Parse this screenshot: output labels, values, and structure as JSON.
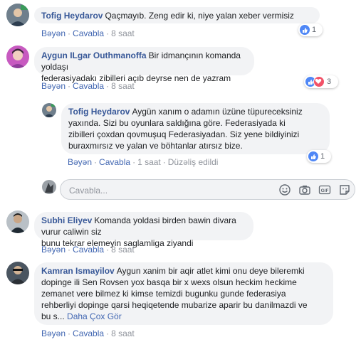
{
  "comments": [
    {
      "author": "Tofig Heydarov",
      "text": "Qaçmayıb. Zeng edir ki, niye yalan xeber vermisiz",
      "like_label": "Bəyən",
      "reply_label": "Cavabla",
      "time": "8 saat",
      "reaction_count": "1"
    },
    {
      "author": "Aygun ILgar Outhmanoffa",
      "text_lines": [
        "Bir idmançının komanda yoldaşı",
        "federasiyadakı zibilleri açıb deyrse nen de yazram"
      ],
      "like_label": "Bəyən",
      "reply_label": "Cavabla",
      "time": "8 saat",
      "reaction_count": "3",
      "reply": {
        "author": "Tofig Heydarov",
        "text_lines": [
          "Aygün xanım o adamın üzüne tüpureceksiniz",
          "yaxında. Sizi bu oyunlara saldığına göre. Federasiyada ki",
          "zibilleri çoxdan qovmuşuq Federasiyadan. Siz yene bildiyinizi",
          "buraxmırsız ve yalan ve böhtanlar atırsız bize."
        ],
        "like_label": "Bəyən",
        "reply_label": "Cavabla",
        "time": "1 saat",
        "edited_label": "Düzəliş edildi",
        "reaction_count": "1"
      },
      "reply_box": {
        "placeholder": "Cavabla...",
        "icons": [
          "emoji-icon",
          "camera-icon",
          "gif-icon",
          "sticker-icon"
        ]
      }
    },
    {
      "author": "Subhi Eliyev",
      "text_lines": [
        "Komanda yoldasi birden bawin divara vurur caliwin siz",
        "bunu tekrar elemeyin saglamliga ziyandi"
      ],
      "like_label": "Bəyən",
      "reply_label": "Cavabla",
      "time": "8 saat"
    },
    {
      "author": "Kamran Ismayilov",
      "text_lines": [
        "Aygun xanim bir aqir atlet kimi onu deye bileremki",
        "dopinge ili Sen Rovsen yox basqa bir x wexs olsun heckim heckime",
        "zemanet vere bilmez ki kimse temizdi bugunku gunde federasiya",
        "rehberliyi dopinge qarsi heqiqetende mubarize aparir bu danilmazdi ve",
        "bu s..."
      ],
      "see_more": "Daha Çox Gör",
      "like_label": "Bəyən",
      "reply_label": "Cavabla",
      "time": "8 saat"
    }
  ],
  "colors": {
    "name": "#385898",
    "link": "#4267b2",
    "meta": "#90949c",
    "bubble": "#f2f3f5",
    "like": "#4f87f6",
    "love": "#f25268"
  }
}
